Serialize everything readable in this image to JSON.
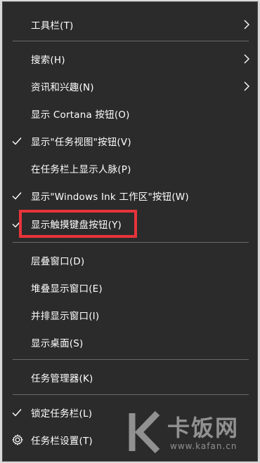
{
  "menu": {
    "items": [
      {
        "label": "工具栏(T)",
        "checked": false,
        "submenu": true
      },
      {
        "label": "搜索(H)",
        "checked": false,
        "submenu": true
      },
      {
        "label": "资讯和兴趣(N)",
        "checked": false,
        "submenu": true
      },
      {
        "label": "显示 Cortana 按钮(O)",
        "checked": false,
        "submenu": false
      },
      {
        "label": "显示\"任务视图\"按钮(V)",
        "checked": true,
        "submenu": false
      },
      {
        "label": "在任务栏上显示人脉(P)",
        "checked": false,
        "submenu": false
      },
      {
        "label": "显示\"Windows Ink 工作区\"按钮(W)",
        "checked": true,
        "submenu": false
      },
      {
        "label": "显示触摸键盘按钮(Y)",
        "checked": true,
        "submenu": false
      },
      {
        "label": "层叠窗口(D)",
        "checked": false,
        "submenu": false
      },
      {
        "label": "堆叠显示窗口(E)",
        "checked": false,
        "submenu": false
      },
      {
        "label": "并排显示窗口(I)",
        "checked": false,
        "submenu": false
      },
      {
        "label": "显示桌面(S)",
        "checked": false,
        "submenu": false
      },
      {
        "label": "任务管理器(K)",
        "checked": false,
        "submenu": false
      },
      {
        "label": "锁定任务栏(L)",
        "checked": true,
        "submenu": false
      },
      {
        "label": "任务栏设置(T)",
        "checked": false,
        "submenu": false,
        "icon": "gear-icon"
      }
    ]
  },
  "watermark": {
    "brand": "卡饭网",
    "url": "www.kafan.cn"
  },
  "colors": {
    "menu_bg": "#2b2b2b",
    "text": "#ffffff",
    "separator": "#6a6a6a",
    "highlight_box": "#e8343a"
  }
}
